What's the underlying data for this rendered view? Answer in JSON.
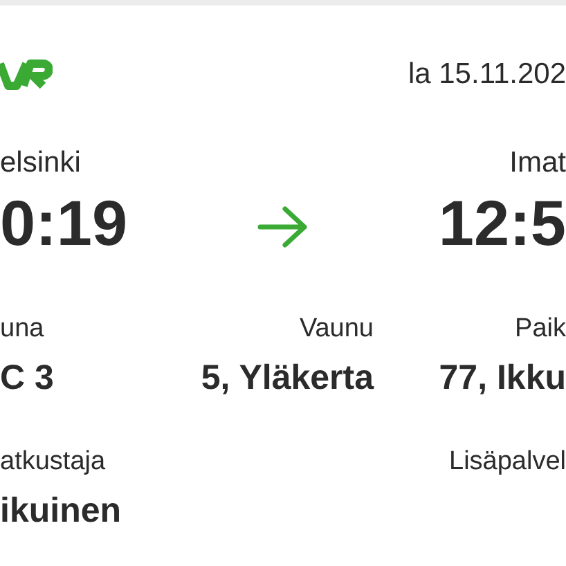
{
  "header": {
    "date": "la 15.11.202"
  },
  "route": {
    "from": {
      "station": "elsinki",
      "time": "0:19"
    },
    "to": {
      "station": "Imat",
      "time": "12:5"
    }
  },
  "details": [
    {
      "label": "una",
      "value": "C 3"
    },
    {
      "label": "Vaunu",
      "value": "5, Yläkerta"
    },
    {
      "label": "Paik",
      "value": "77, Ikku"
    }
  ],
  "passenger": {
    "label": "atkustaja",
    "value": "ikuinen"
  },
  "extras": {
    "label": "Lisäpalvel"
  }
}
